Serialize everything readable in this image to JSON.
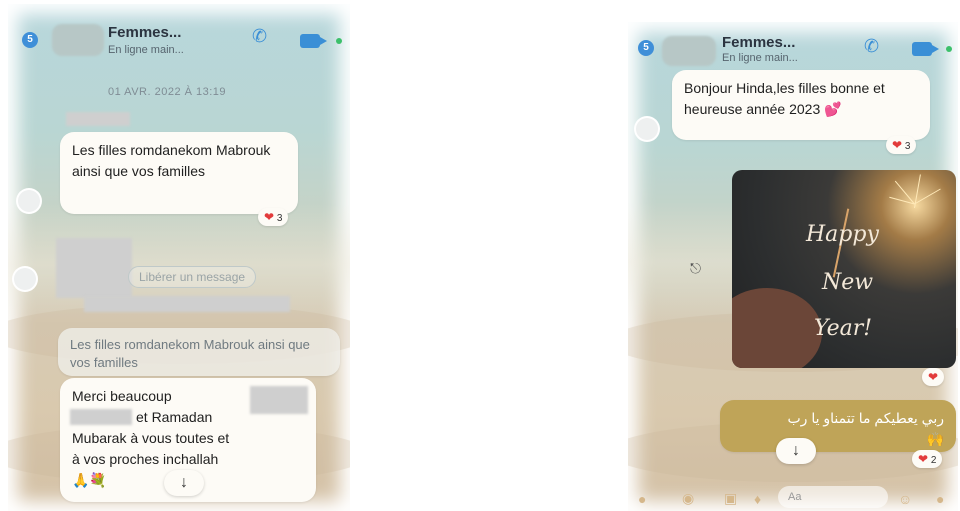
{
  "left_screen": {
    "header": {
      "back_badge": "5",
      "title": "Femmes...",
      "subtitle": "En ligne main..."
    },
    "date_separator": "01 AVR. 2022 À 13:19",
    "messages": [
      {
        "text": "Les filles romdanekom Mabrouk ainsi que  vos familles",
        "reaction": "3"
      }
    ],
    "reply_pill": "Libérer un message",
    "quoted_text": "Les filles romdanekom Mabrouk ainsi que  vos  familles",
    "reply_message": {
      "line1": "Merci beaucoup",
      "line2": "et Ramadan",
      "line3": "Mubarak à vous toutes et",
      "line4": "à vos proches inchallah",
      "emojis": "🙏💐"
    },
    "scroll_down": "↓"
  },
  "right_screen": {
    "header": {
      "back_badge": "5",
      "title": "Femmes...",
      "subtitle": "En ligne main..."
    },
    "messages": [
      {
        "text": "Bonjour Hinda,les filles bonne et heureuse année 2023 💕",
        "reaction": "3"
      }
    ],
    "image_text": [
      "Happy",
      "New",
      "Year!"
    ],
    "image_reaction": "",
    "arabic_message": {
      "text": "ربي يعطيكم ما تتمناو يا رب",
      "emojis": "🙌",
      "reaction": "2"
    },
    "scroll_down": "↓",
    "composer_placeholder": "Aa"
  },
  "colors": {
    "accent": "#3a8fd6",
    "bubble": "#fdfbf6",
    "gold_bubble": "#bfa458",
    "heart": "#e23b3b"
  }
}
